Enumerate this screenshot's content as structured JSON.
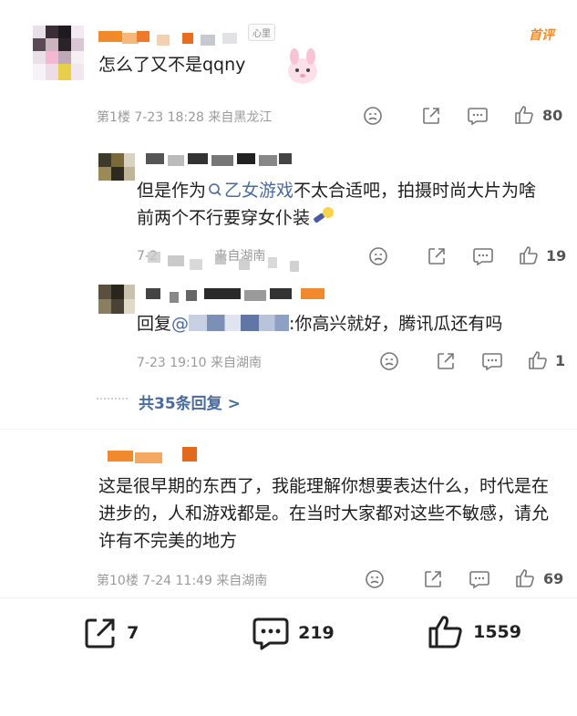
{
  "comment1": {
    "badge": "心里",
    "hot_tag": "首评",
    "text": "怎么了又不是qqny",
    "floor": "第1楼",
    "time": "7-23 18:28",
    "location": "来自黑龙江",
    "repost_count": "",
    "comment_count": "",
    "like_count": "80"
  },
  "reply1": {
    "text_before": "但是作为",
    "topic_link": "乙女游戏",
    "text_after": "不太合适吧，拍摄时尚大片为啥前两个不行要穿女仆装",
    "time": "7-2",
    "location": "来自湖南",
    "like_count": "19"
  },
  "reply2": {
    "prefix": "回复",
    "mention": "@",
    "text": ":你高兴就好，腾讯瓜还有吗",
    "time": "7-23 19:10",
    "location": "来自湖南",
    "like_count": "1"
  },
  "more_replies": "共35条回复 >",
  "comment2": {
    "text": "这是很早期的东西了，我能理解你想要表达什么，时代是在进步的，人和游戏都是。在当时大家都对这些不敏感，请允许有不完美的地方",
    "floor": "第10楼",
    "time": "7-24 11:49",
    "location": "来自湖南",
    "like_count": "69"
  },
  "bottom_bar": {
    "share_count": "7",
    "comment_count": "219",
    "like_count": "1559"
  },
  "colors": {
    "accent_orange": "#f08a2c",
    "link_blue": "#4a6a9c",
    "meta_gray": "#9a9a9a"
  }
}
